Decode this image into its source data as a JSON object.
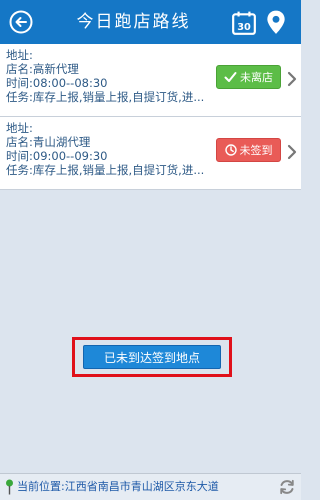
{
  "header": {
    "title": "今日跑店路线",
    "calendar_day": "30"
  },
  "stores": [
    {
      "address_label": "地址:",
      "address": "",
      "name_label": "店名:",
      "name": "高新代理",
      "time_label": "时间:",
      "time": "08:00--08:30",
      "task_label": "任务:",
      "task": "库存上报,销量上报,自提订货,进...",
      "status": "未离店",
      "status_icon": "check-icon",
      "status_color": "#5cbd47"
    },
    {
      "address_label": "地址:",
      "address": "",
      "name_label": "店名:",
      "name": "青山湖代理",
      "time_label": "时间:",
      "time": "09:00--09:30",
      "task_label": "任务:",
      "task": "库存上报,销量上报,自提订货,进...",
      "status": "未签到",
      "status_icon": "clock-icon",
      "status_color": "#e95b57"
    }
  ],
  "confirm_button": "已未到达签到地点",
  "footer": {
    "location_label": "当前位置:",
    "location": "江西省南昌市青山湖区京东大道"
  },
  "colors": {
    "header": "#1577c6",
    "background": "#dce4ee",
    "highlight": "#e0101a"
  }
}
